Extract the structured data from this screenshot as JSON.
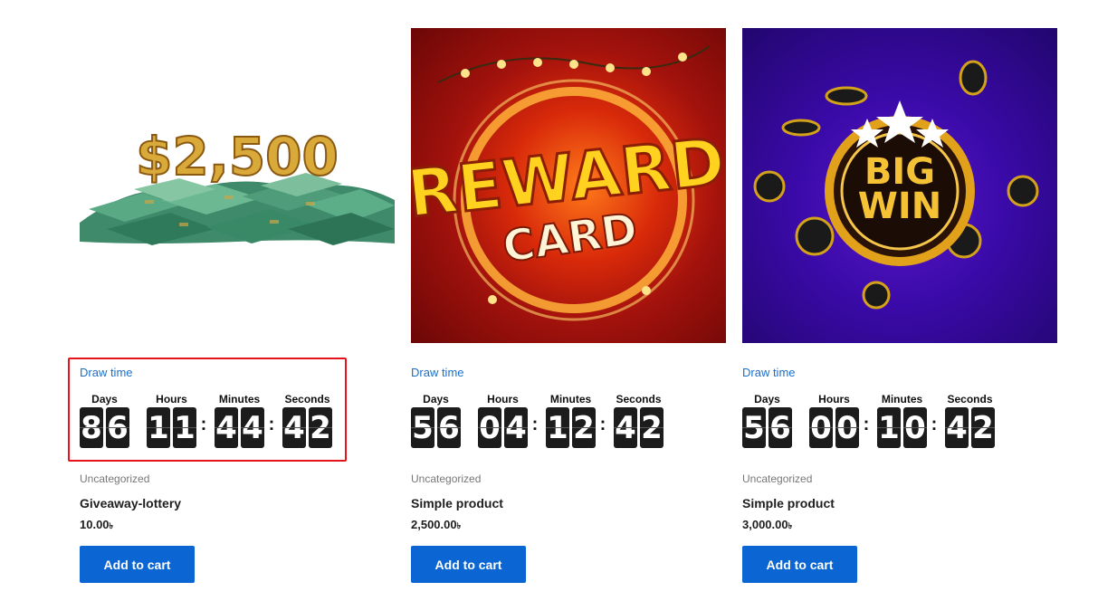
{
  "products": [
    {
      "image_alt": "$2,500",
      "draw_link": "Draw time",
      "countdown": {
        "labels": [
          "Days",
          "Hours",
          "Minutes",
          "Seconds"
        ],
        "days": [
          "8",
          "6"
        ],
        "hours": [
          "1",
          "1"
        ],
        "minutes": [
          "4",
          "4"
        ],
        "seconds": [
          "4",
          "2"
        ]
      },
      "category": "Uncategorized",
      "title": "Giveaway-lottery",
      "price": "10.00",
      "currency": "৳",
      "button": "Add to cart"
    },
    {
      "image_alt": "REWARD CARD",
      "draw_link": "Draw time",
      "countdown": {
        "labels": [
          "Days",
          "Hours",
          "Minutes",
          "Seconds"
        ],
        "days": [
          "5",
          "6"
        ],
        "hours": [
          "0",
          "4"
        ],
        "minutes": [
          "1",
          "2"
        ],
        "seconds": [
          "4",
          "2"
        ]
      },
      "category": "Uncategorized",
      "title": "Simple product",
      "price": "2,500.00",
      "currency": "৳",
      "button": "Add to cart"
    },
    {
      "image_alt": "BIG WIN",
      "draw_link": "Draw time",
      "countdown": {
        "labels": [
          "Days",
          "Hours",
          "Minutes",
          "Seconds"
        ],
        "days": [
          "5",
          "6"
        ],
        "hours": [
          "0",
          "0"
        ],
        "minutes": [
          "1",
          "0"
        ],
        "seconds": [
          "4",
          "2"
        ]
      },
      "category": "Uncategorized",
      "title": "Simple product",
      "price": "3,000.00",
      "currency": "৳",
      "button": "Add to cart"
    }
  ],
  "image_text": {
    "cash": "$2,500",
    "reward_1": "REWARD",
    "reward_2": "CARD",
    "bigwin_1": "BIG",
    "bigwin_2": "WIN"
  },
  "colors": {
    "link": "#1b6fc9",
    "button": "#0b66d3",
    "highlight": "#e4131c",
    "digit_bg": "#1c1c1c"
  }
}
